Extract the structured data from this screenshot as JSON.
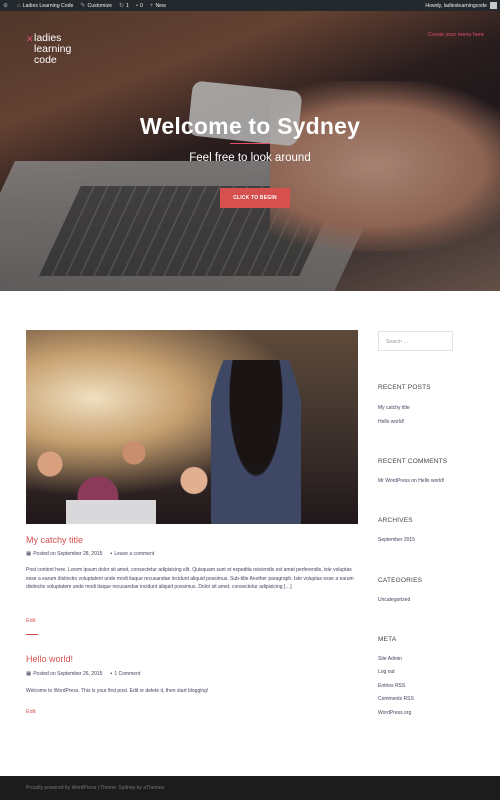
{
  "admin_bar": {
    "site_name": "Ladies Learning Code",
    "customize": "Customize",
    "updates_count": "1",
    "comments_count": "0",
    "new_label": "New",
    "howdy": "Howdy, ladieslearningcode"
  },
  "header": {
    "logo_line1": "ladies",
    "logo_line2": "learning",
    "logo_line3": "code",
    "menu_link": "Create your menu here"
  },
  "hero": {
    "title": "Welcome to Sydney",
    "subtitle": "Feel free to look around",
    "button_label": "CLICK TO BEGIN"
  },
  "posts": [
    {
      "title": "My catchy title",
      "date": "Posted on September 28, 2015",
      "comments": "Leave a comment",
      "excerpt": "Post content here.   Lorem ipsum dolor sit amet, consectetur adipisicing elit. Quisquam sunt et expedita reiciendis est amet perferendis, iste voluptas esse a earum distinctio voluptatem unde modi itaque recusandae incidunt aliquid possimus. Sub-title Another paragraph. Iste voluptas esse a earum distinctio voluptatem unde modi itaque recusandae incidunt aliquid possimus. Dolor sit amet, consectetur adipisicing […]",
      "edit": "Edit"
    },
    {
      "title": "Hello world!",
      "date": "Posted on September 26, 2015",
      "comments": "1 Comment",
      "excerpt": "Welcome to WordPress. This is your first post. Edit or delete it, then start blogging!",
      "edit": "Edit"
    }
  ],
  "sidebar": {
    "search_placeholder": "Search …",
    "recent_posts_title": "RECENT POSTS",
    "recent_posts": [
      "My catchy title",
      "Hello world!"
    ],
    "recent_comments_title": "RECENT COMMENTS",
    "recent_comment": "Mr WordPress on Hello world!",
    "archives_title": "ARCHIVES",
    "archive": "September 2015",
    "categories_title": "CATEGORIES",
    "category": "Uncategorized",
    "meta_title": "META",
    "meta_links": [
      "Site Admin",
      "Log out",
      "Entries RSS",
      "Comments RSS",
      "WordPress.org"
    ]
  },
  "footer": {
    "text": "Proudly powered by WordPress | Theme: Sydney by aThemes."
  },
  "colors": {
    "accent": "#d65050",
    "admin_bar": "#23282d",
    "footer": "#1c1c1c"
  }
}
